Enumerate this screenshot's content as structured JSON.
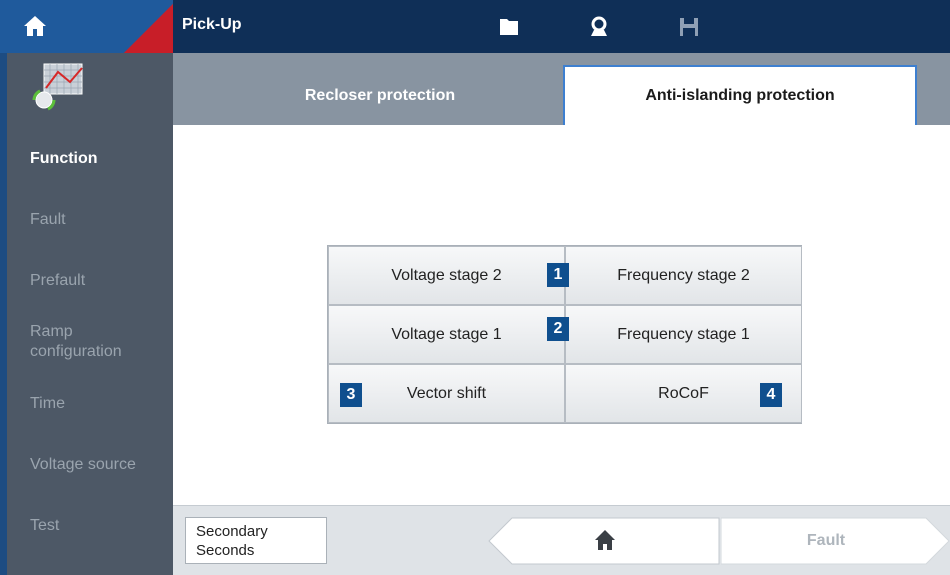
{
  "header": {
    "title": "Pick-Up",
    "icons": [
      "home-icon",
      "folder-icon",
      "user-icon",
      "save-icon"
    ],
    "accent_color": "#c81e28"
  },
  "sidebar": {
    "items": [
      {
        "label": "Function",
        "active": true
      },
      {
        "label": "Fault",
        "active": false
      },
      {
        "label": "Prefault",
        "active": false
      },
      {
        "label": "Ramp configuration",
        "active": false
      },
      {
        "label": "Time",
        "active": false
      },
      {
        "label": "Voltage source",
        "active": false
      },
      {
        "label": "Test",
        "active": false
      }
    ]
  },
  "tabs": [
    {
      "label": "Recloser protection",
      "active": false
    },
    {
      "label": "Anti-islanding protection",
      "active": true
    }
  ],
  "grid": {
    "cells": [
      {
        "label": "Voltage stage 2"
      },
      {
        "label": "Frequency stage 2"
      },
      {
        "label": "Voltage stage 1"
      },
      {
        "label": "Frequency stage 1"
      },
      {
        "label": "Vector shift"
      },
      {
        "label": "RoCoF"
      }
    ],
    "badges": [
      "1",
      "2",
      "3",
      "4"
    ]
  },
  "footer": {
    "secondary_label": "Secondary Seconds",
    "next_label": "Fault"
  }
}
